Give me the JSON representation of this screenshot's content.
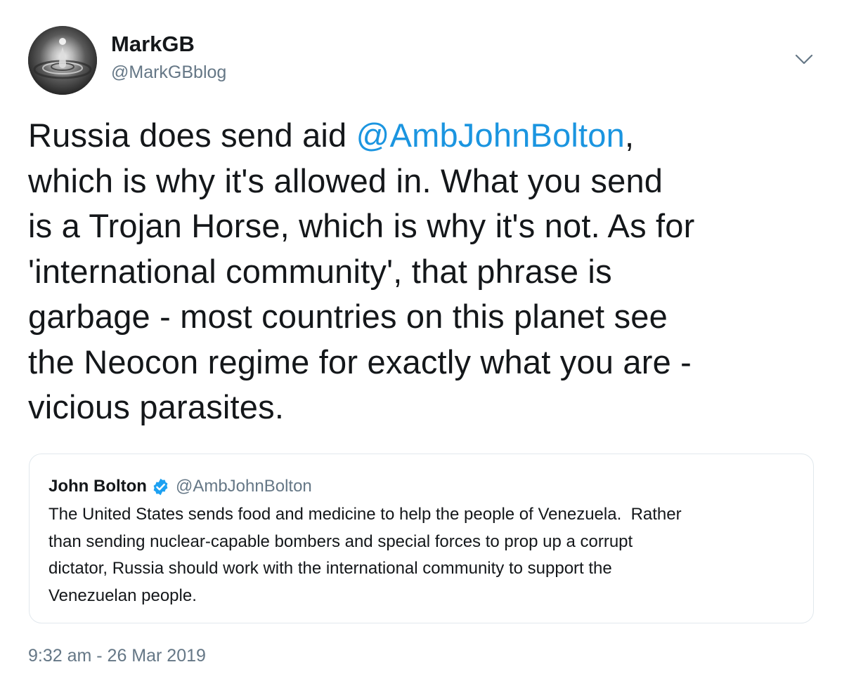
{
  "tweet": {
    "author": {
      "display_name": "MarkGB",
      "handle": "@MarkGBblog",
      "avatar_icon": "water-droplet-avatar"
    },
    "menu_icon": "chevron-down-icon",
    "text_lines": [
      {
        "before": "Russia does send aid ",
        "mention": "@AmbJohnBolton",
        "after": ","
      },
      {
        "text": "which is why it's allowed in. What you send"
      },
      {
        "text": "is a Trojan Horse, which is why it's not. As for"
      },
      {
        "text": "'international community', that phrase is"
      },
      {
        "text": "garbage - most countries on this planet see"
      },
      {
        "text": "the Neocon regime for exactly what you are -"
      },
      {
        "text": "vicious parasites."
      }
    ],
    "timestamp": "9:32 am - 26 Mar 2019",
    "mention_color": "#1b95e0"
  },
  "quoted_tweet": {
    "display_name": "John Bolton",
    "verified_icon": "verified-badge-icon",
    "handle": "@AmbJohnBolton",
    "text_lines": [
      "The United States sends food and medicine to help the people of Venezuela.  Rather",
      "than sending nuclear-capable bombers and special forces to prop up a corrupt",
      "dictator, Russia should work with the international community to support the",
      "Venezuelan people."
    ],
    "verified_color": "#1da1f2"
  }
}
